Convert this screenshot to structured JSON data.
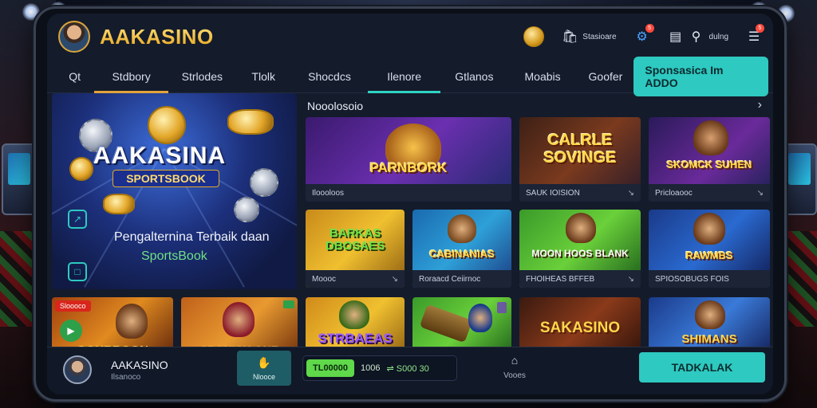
{
  "brand": "AAKASINO",
  "header": {
    "icon_bag_label": "Stasioare",
    "icon_gear_badge": "5",
    "icon_location_label": "dulng",
    "icon_menu_badge": "5"
  },
  "nav": {
    "items": [
      {
        "label": "Qt"
      },
      {
        "label": "Stdbory"
      },
      {
        "label": "Strlodes"
      },
      {
        "label": "Tlolk"
      },
      {
        "label": "Shocdcs"
      },
      {
        "label": "Ilenore"
      },
      {
        "label": "Gtlanos"
      },
      {
        "label": "Moabis"
      },
      {
        "label": "Goofer"
      }
    ],
    "cta": "Sponsasica  Im ADDO"
  },
  "hero": {
    "title": "AAKASINA",
    "subtitle": "SPORTSBOOK",
    "tagline": "Pengalternina Terbaik daan",
    "tagline2": "SportsBook"
  },
  "section": {
    "title": "Nooolosoio"
  },
  "cards": [
    {
      "art": "PARNBORK",
      "caption": "Iloooloos",
      "caption_arrow": ""
    },
    {
      "art": "CALRLE SOVINGE",
      "caption": "SAUK IOISION",
      "caption_arrow": "↘"
    },
    {
      "art": "SKOMCK SUHEN",
      "caption": "Pricloaooc",
      "caption_arrow": "↘"
    },
    {
      "art": "BARKAS DBOSAES",
      "caption": "Moooc",
      "caption_arrow": "↘"
    },
    {
      "art": "CABINANIAS",
      "caption": "Roraacd Ceiirnoc",
      "caption_arrow": ""
    },
    {
      "art": "MOON HOOS BLANK",
      "caption": "FHOIHEAS BFFEB",
      "caption_arrow": "↘"
    },
    {
      "art": "RAWMBS",
      "caption": "SPIOSOBUGS FOIS",
      "caption_arrow": ""
    },
    {
      "art": "GOHBBOON",
      "caption": "",
      "caption_arrow": ""
    },
    {
      "art": "SPONICK GNE",
      "caption": "",
      "caption_arrow": ""
    },
    {
      "art": "STRBAEAS",
      "caption": "",
      "caption_arrow": ""
    },
    {
      "art": "",
      "caption": "",
      "caption_arrow": ""
    },
    {
      "art": "SAKASINO",
      "caption": "",
      "caption_arrow": ""
    },
    {
      "art": "SHIMANS",
      "caption": "",
      "caption_arrow": ""
    }
  ],
  "card_badges": {
    "red": "Sloooco"
  },
  "bottom": {
    "user_name": "AAKASINO",
    "user_sub": "Ilsanoco",
    "tile_label": "Nlooce",
    "balance_pill": "TL00000",
    "balance_mid": "1006",
    "balance_right": "⇌ S000 30",
    "nav_label": "Vooes",
    "cta": "TADKALAK"
  },
  "colors": {
    "accent_teal": "#2ec9c0",
    "accent_gold": "#e2a33c",
    "accent_green": "#5fd84a"
  }
}
